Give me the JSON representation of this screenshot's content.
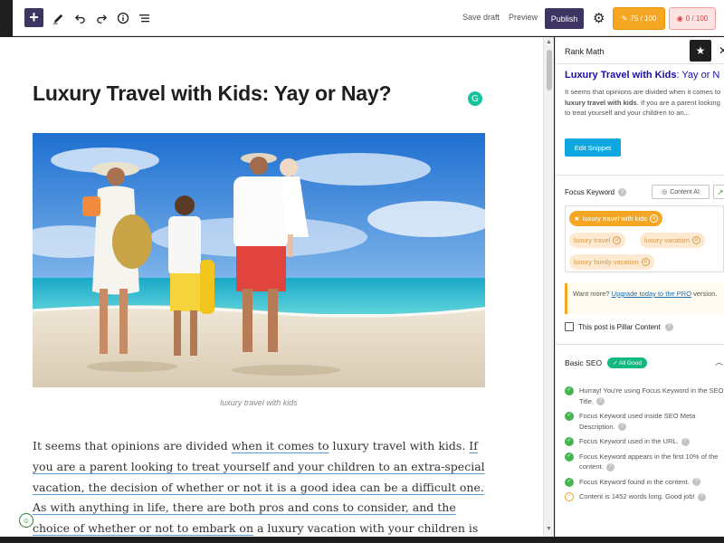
{
  "toolbar": {
    "add": "+",
    "save_draft": "Save draft",
    "preview": "Preview",
    "publish": "Publish",
    "seo_score": "75 / 100",
    "readability_score": "0 / 100"
  },
  "post": {
    "title": "Luxury Travel with Kids: Yay or Nay?",
    "image_caption": "luxury travel with kids",
    "body": [
      "It seems that opinions are divided ",
      "when it comes to",
      " luxury travel with kids. ",
      "If you are a parent looking to treat yourself and your children to an extra-special vacation, the decision of whether or not it is a good idea can be a difficult one.",
      " ",
      "As with anything in life, there are both pros and cons to consider, and the choice of whether or not to embark on",
      " a luxury vacation with your children is ultimately up to you and the unique family"
    ]
  },
  "sidebar": {
    "title": "Rank Math",
    "snippet": {
      "title_keyword": "Luxury Travel with Kids",
      "title_rest": ": Yay or N",
      "desc_1": "It seems that opinions are divided when it comes to ",
      "desc_bold_1": "luxury travel with kids",
      "desc_2": ". If you are a parent looking to treat yourself and your children to an...",
      "edit_button": "Edit Snippet"
    },
    "focus_keyword": {
      "label": "Focus Keyword",
      "content_ai": "Content AI",
      "keywords": [
        "luxury travel with kids",
        "luxury travel",
        "luxury vacation",
        "luxury family vacation"
      ]
    },
    "promo": {
      "text": "Want more? ",
      "link": "Upgrade today to the PRO",
      "text_end": " version."
    },
    "pillar_label": "This post is Pillar Content",
    "basic_seo": {
      "label": "Basic SEO",
      "badge": "✓ All Good",
      "checks": [
        "Hurray! You're using Focus Keyword in the SEO Title.",
        "Focus Keyword used inside SEO Meta Description.",
        "Focus Keyword used in the URL.",
        "Focus Keyword appears in the first 10% of the content.",
        "Focus Keyword found in the content.",
        "Content is 1452 words long. Good job!"
      ]
    }
  },
  "colors": {
    "publish": "#3d3461",
    "seo_score": "#f5a623",
    "readability": "#d64545",
    "good": "#46b450",
    "link": "#1a0dab"
  }
}
